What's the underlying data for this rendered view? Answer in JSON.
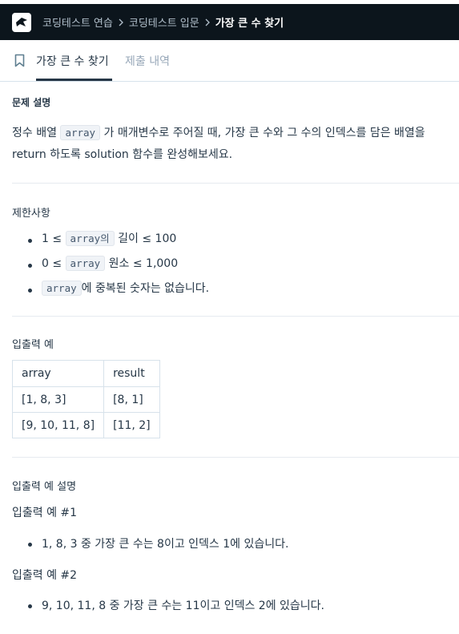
{
  "header": {
    "breadcrumbs": [
      "코딩테스트 연습",
      "코딩테스트 입문",
      "가장 큰 수 찾기"
    ]
  },
  "tabs": {
    "active": "가장 큰 수 찾기",
    "inactive": "제출 내역"
  },
  "description": {
    "heading": "문제 설명",
    "p1_a": "정수 배열",
    "p1_code": "array",
    "p1_b": "가 매개변수로 주어질 때, 가장 큰 수와 그 수의 인덱스를 담은 배열을",
    "p2": "return 하도록 solution 함수를 완성해보세요."
  },
  "constraints": {
    "heading": "제한사항",
    "items": [
      {
        "pre": "1 ≤",
        "code": "array의",
        "post": "길이 ≤ 100"
      },
      {
        "pre": "0 ≤",
        "code": "array",
        "post": "원소 ≤ 1,000"
      },
      {
        "pre": "",
        "code": "array",
        "post": "에 중복된 숫자는 없습니다."
      }
    ]
  },
  "examples": {
    "heading": "입출력 예",
    "headers": [
      "array",
      "result"
    ],
    "rows": [
      [
        "[1, 8, 3]",
        "[8, 1]"
      ],
      [
        "[9, 10, 11, 8]",
        "[11, 2]"
      ]
    ]
  },
  "explanation": {
    "heading": "입출력 예 설명",
    "ex1_title": "입출력 예 #1",
    "ex1_item": "1, 8, 3 중 가장 큰 수는 8이고 인덱스 1에 있습니다.",
    "ex2_title": "입출력 예 #2",
    "ex2_item": "9, 10, 11, 8 중 가장 큰 수는 11이고 인덱스 2에 있습니다."
  },
  "colors": {
    "header_bg": "#0c151c",
    "text": "#263747",
    "muted": "#98a8b9"
  }
}
